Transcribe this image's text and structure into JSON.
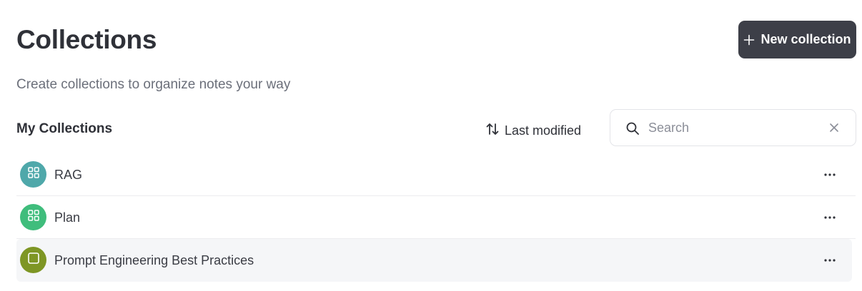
{
  "header": {
    "title": "Collections",
    "subtitle": "Create collections to organize notes your way",
    "new_collection_label": "New collection"
  },
  "section": {
    "title": "My Collections",
    "sort_label": "Last modified"
  },
  "search": {
    "placeholder": "Search",
    "value": ""
  },
  "collections": [
    {
      "name": "RAG",
      "icon": "grid-icon",
      "color": "#4fa8aa"
    },
    {
      "name": "Plan",
      "icon": "grid-icon",
      "color": "#3fbd7c"
    },
    {
      "name": "Prompt Engineering Best Practices",
      "icon": "square-icon",
      "color": "#7e9624"
    }
  ],
  "colors": {
    "primary_button": "#3d3f48",
    "hover_row": "#f5f6f8"
  }
}
